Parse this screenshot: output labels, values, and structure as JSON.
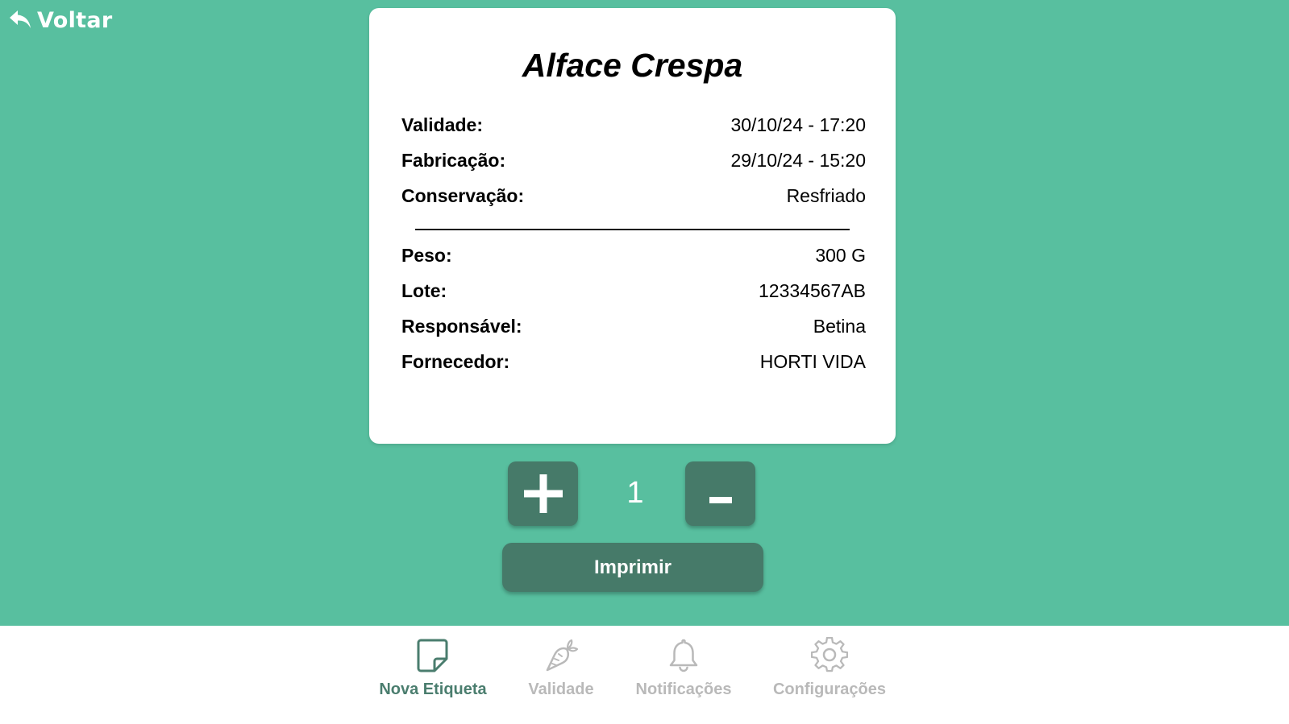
{
  "header": {
    "back_label": "Voltar",
    "back_icon": "reply-arrow-icon"
  },
  "label_card": {
    "title": "Alface Crespa",
    "rows_top": [
      {
        "key": "Validade:",
        "value": "30/10/24 - 17:20"
      },
      {
        "key": "Fabricação:",
        "value": "29/10/24 - 15:20"
      },
      {
        "key": "Conservação:",
        "value": "Resfriado"
      }
    ],
    "rows_bottom": [
      {
        "key": "Peso:",
        "value": "300 G"
      },
      {
        "key": "Lote:",
        "value": "12334567AB"
      },
      {
        "key": "Responsável:",
        "value": "Betina"
      },
      {
        "key": "Fornecedor:",
        "value": "HORTI VIDA"
      }
    ]
  },
  "quantity": {
    "value": "1",
    "increment_icon": "plus-icon",
    "decrement_icon": "minus-icon"
  },
  "actions": {
    "print_label": "Imprimir"
  },
  "bottom_nav": {
    "items": [
      {
        "label": "Nova Etiqueta",
        "icon": "sticky-note-icon",
        "active": true
      },
      {
        "label": "Validade",
        "icon": "carrot-icon",
        "active": false
      },
      {
        "label": "Notificações",
        "icon": "bell-icon",
        "active": false
      },
      {
        "label": "Configurações",
        "icon": "gear-icon",
        "active": false
      }
    ]
  },
  "colors": {
    "background": "#58bf9f",
    "button": "#467a69",
    "nav_active": "#4a7d6e",
    "nav_inactive": "#b9b9b9",
    "card": "#ffffff"
  }
}
